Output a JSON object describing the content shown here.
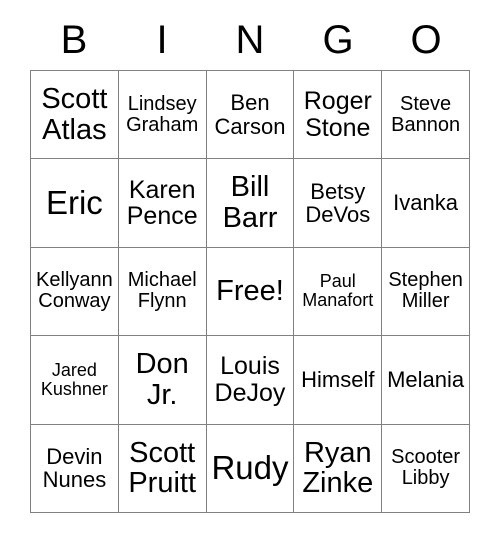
{
  "card": {
    "header_letters": [
      "B",
      "I",
      "N",
      "G",
      "O"
    ],
    "grid": {
      "rows": 5,
      "columns": 5,
      "border_color": "#808080",
      "background_color": "#ffffff",
      "text_color": "#000000"
    },
    "cells": [
      {
        "text": "Scott\nAtlas",
        "size": "xl"
      },
      {
        "text": "Lindsey\nGraham",
        "size": "s"
      },
      {
        "text": "Ben\nCarson",
        "size": "m"
      },
      {
        "text": "Roger\nStone",
        "size": "l"
      },
      {
        "text": "Steve\nBannon",
        "size": "s"
      },
      {
        "text": "Eric",
        "size": "xxl"
      },
      {
        "text": "Karen\nPence",
        "size": "l"
      },
      {
        "text": "Bill\nBarr",
        "size": "xl"
      },
      {
        "text": "Betsy\nDeVos",
        "size": "m"
      },
      {
        "text": "Ivanka",
        "size": "m"
      },
      {
        "text": "Kellyann\nConway",
        "size": "s"
      },
      {
        "text": "Michael\nFlynn",
        "size": "s"
      },
      {
        "text": "Free!",
        "size": "xl"
      },
      {
        "text": "Paul\nManafort",
        "size": "xs"
      },
      {
        "text": "Stephen\nMiller",
        "size": "s"
      },
      {
        "text": "Jared\nKushner",
        "size": "xs"
      },
      {
        "text": "Don\nJr.",
        "size": "xl"
      },
      {
        "text": "Louis\nDeJoy",
        "size": "l"
      },
      {
        "text": "Himself",
        "size": "m"
      },
      {
        "text": "Melania",
        "size": "m"
      },
      {
        "text": "Devin\nNunes",
        "size": "m"
      },
      {
        "text": "Scott\nPruitt",
        "size": "xl"
      },
      {
        "text": "Rudy",
        "size": "xxl"
      },
      {
        "text": "Ryan\nZinke",
        "size": "xl"
      },
      {
        "text": "Scooter\nLibby",
        "size": "s"
      }
    ]
  }
}
